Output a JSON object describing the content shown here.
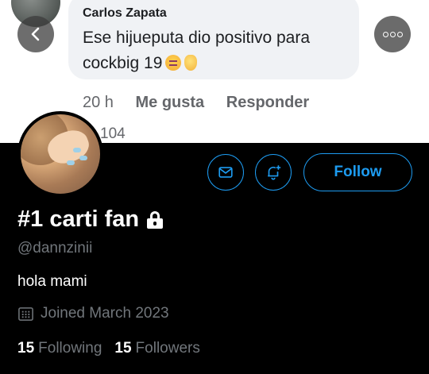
{
  "comment": {
    "author": "Carlos Zapata",
    "text": "Ese hijueputa dio positivo para cockbig 19",
    "time": "20 h",
    "like_label": "Me gusta",
    "reply_label": "Responder",
    "reaction_count": "104"
  },
  "profile": {
    "display_name": "#1 carti fan",
    "handle": "@dannzinii",
    "bio": "hola mami",
    "joined": "Joined March 2023",
    "follow_label": "Follow",
    "following_count": "15",
    "following_label": "Following",
    "followers_count": "15",
    "followers_label": "Followers"
  },
  "colors": {
    "accent": "#1d9bf0",
    "muted": "#71767b",
    "background": "#000000"
  },
  "icons": [
    "back-arrow-icon",
    "more-icon",
    "mail-icon",
    "bell-plus-icon",
    "lock-icon",
    "calendar-icon"
  ]
}
